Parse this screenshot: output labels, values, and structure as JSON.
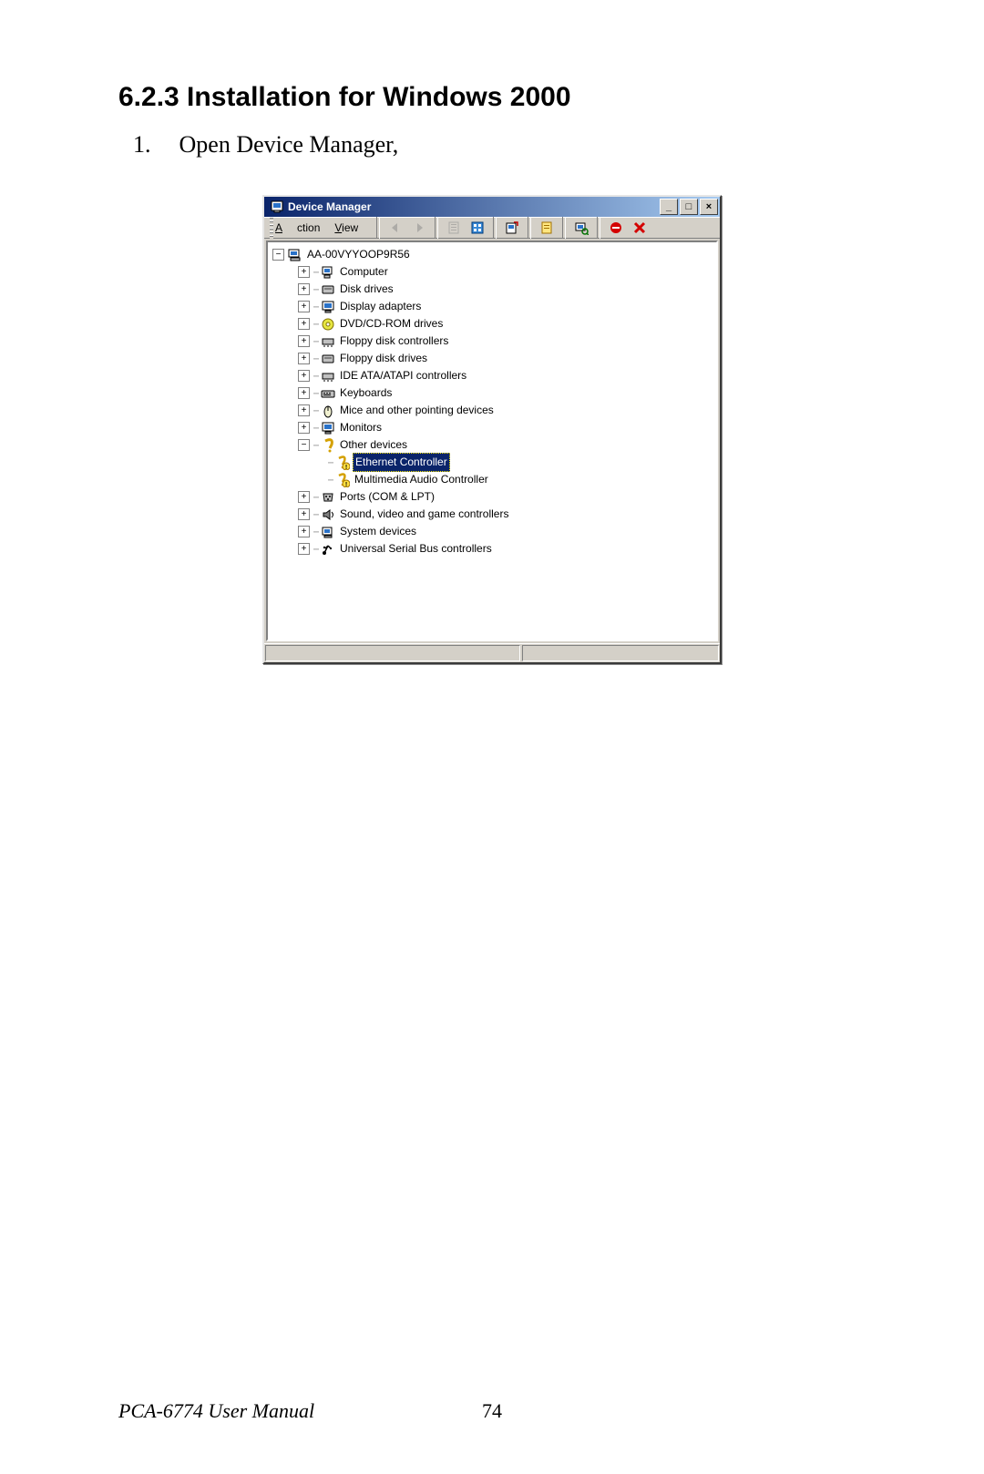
{
  "doc": {
    "heading": "6.2.3 Installation for Windows 2000",
    "step_num": "1.",
    "step_text": "Open Device Manager,",
    "footer_left": "PCA-6774 User Manual",
    "footer_page": "74"
  },
  "window": {
    "title": "Device Manager",
    "btn_min": "_",
    "btn_max": "□",
    "btn_close": "×",
    "menu_action": "Action",
    "menu_view": "View"
  },
  "toolbar": {
    "back": "back-icon",
    "forward": "forward-icon",
    "clipboard": "clipboard-icon",
    "list": "list-icon",
    "refresh": "refresh-icon",
    "properties": "properties-icon",
    "find": "find-icon",
    "disable": "disable-icon",
    "uninstall": "uninstall-icon"
  },
  "tree": {
    "root": "AA-00VYYOOP9R56",
    "items": [
      {
        "label": "Computer",
        "icon": "computer",
        "exp": "+",
        "depth": 1,
        "sel": false
      },
      {
        "label": "Disk drives",
        "icon": "disk",
        "exp": "+",
        "depth": 1,
        "sel": false
      },
      {
        "label": "Display adapters",
        "icon": "display",
        "exp": "+",
        "depth": 1,
        "sel": false
      },
      {
        "label": "DVD/CD-ROM drives",
        "icon": "cdrom",
        "exp": "+",
        "depth": 1,
        "sel": false
      },
      {
        "label": "Floppy disk controllers",
        "icon": "controller",
        "exp": "+",
        "depth": 1,
        "sel": false
      },
      {
        "label": "Floppy disk drives",
        "icon": "floppy",
        "exp": "+",
        "depth": 1,
        "sel": false
      },
      {
        "label": "IDE ATA/ATAPI controllers",
        "icon": "controller",
        "exp": "+",
        "depth": 1,
        "sel": false
      },
      {
        "label": "Keyboards",
        "icon": "keyboard",
        "exp": "+",
        "depth": 1,
        "sel": false
      },
      {
        "label": "Mice and other pointing devices",
        "icon": "mouse",
        "exp": "+",
        "depth": 1,
        "sel": false
      },
      {
        "label": "Monitors",
        "icon": "display",
        "exp": "+",
        "depth": 1,
        "sel": false
      },
      {
        "label": "Other devices",
        "icon": "question",
        "exp": "-",
        "depth": 1,
        "sel": false
      },
      {
        "label": "Ethernet Controller",
        "icon": "question-item",
        "exp": "",
        "depth": 2,
        "sel": true
      },
      {
        "label": "Multimedia Audio Controller",
        "icon": "question-item",
        "exp": "",
        "depth": 2,
        "sel": false
      },
      {
        "label": "Ports (COM & LPT)",
        "icon": "port",
        "exp": "+",
        "depth": 1,
        "sel": false
      },
      {
        "label": "Sound, video and game controllers",
        "icon": "sound",
        "exp": "+",
        "depth": 1,
        "sel": false
      },
      {
        "label": "System devices",
        "icon": "system",
        "exp": "+",
        "depth": 1,
        "sel": false
      },
      {
        "label": "Universal Serial Bus controllers",
        "icon": "usb",
        "exp": "+",
        "depth": 1,
        "sel": false
      }
    ]
  }
}
